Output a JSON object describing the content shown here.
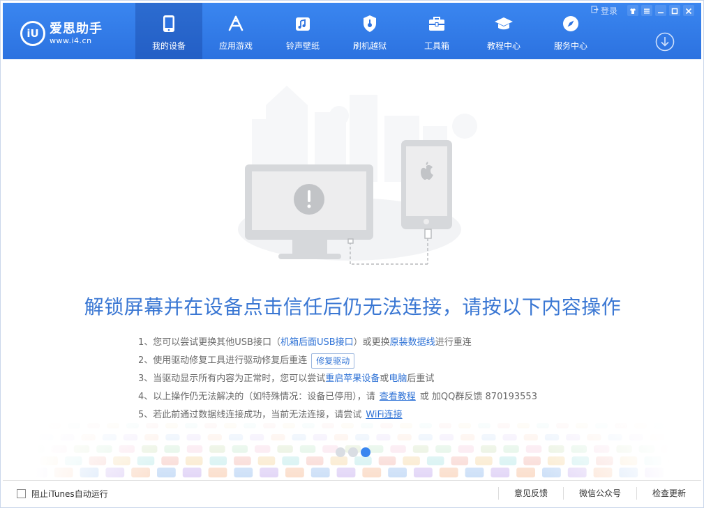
{
  "brand": {
    "name": "爱思助手",
    "url": "www.i4.cn",
    "mark": "iU"
  },
  "nav": [
    {
      "label": "我的设备",
      "icon": "phone-icon",
      "active": true
    },
    {
      "label": "应用游戏",
      "icon": "app-store-icon",
      "active": false
    },
    {
      "label": "铃声壁纸",
      "icon": "music-icon",
      "active": false
    },
    {
      "label": "刷机越狱",
      "icon": "shield-icon",
      "active": false
    },
    {
      "label": "工具箱",
      "icon": "toolbox-icon",
      "active": false
    },
    {
      "label": "教程中心",
      "icon": "graduation-cap-icon",
      "active": false
    },
    {
      "label": "服务中心",
      "icon": "compass-icon",
      "active": false
    }
  ],
  "window": {
    "login": "登录"
  },
  "main": {
    "title": "解锁屏幕并在设备点击信任后仍无法连接，请按以下内容操作",
    "steps": {
      "s1": {
        "a": "1、您可以尝试更换其他USB接口（",
        "link1": "机箱后面USB接口",
        "b": "）或更换",
        "link2": "原装数据线",
        "c": "进行重连"
      },
      "s2": {
        "a": "2、使用驱动修复工具进行驱动修复后重连",
        "button": "修复驱动"
      },
      "s3": {
        "a": "3、当驱动显示所有内容为正常时，您可以尝试",
        "link1": "重启苹果设备",
        "b": "或",
        "link2": "电脑",
        "c": "后重试"
      },
      "s4": {
        "a": "4、以上操作仍无法解决的（如特殊情况：设备已停用），请",
        "link1": "查看教程",
        "b": "或 加QQ群反馈 870193553"
      },
      "s5": {
        "a": "5、若此前通过数据线连接成功，当前无法连接，请尝试",
        "link1": "WiFi连接"
      }
    }
  },
  "status": {
    "itunes_option": "阻止iTunes自动运行",
    "itunes_checked": false,
    "feedback": "意见反馈",
    "wechat": "微信公众号",
    "update": "检查更新"
  },
  "colors": {
    "header": "#2c7be5",
    "title": "#3a77d3",
    "link": "#2e72d6"
  }
}
